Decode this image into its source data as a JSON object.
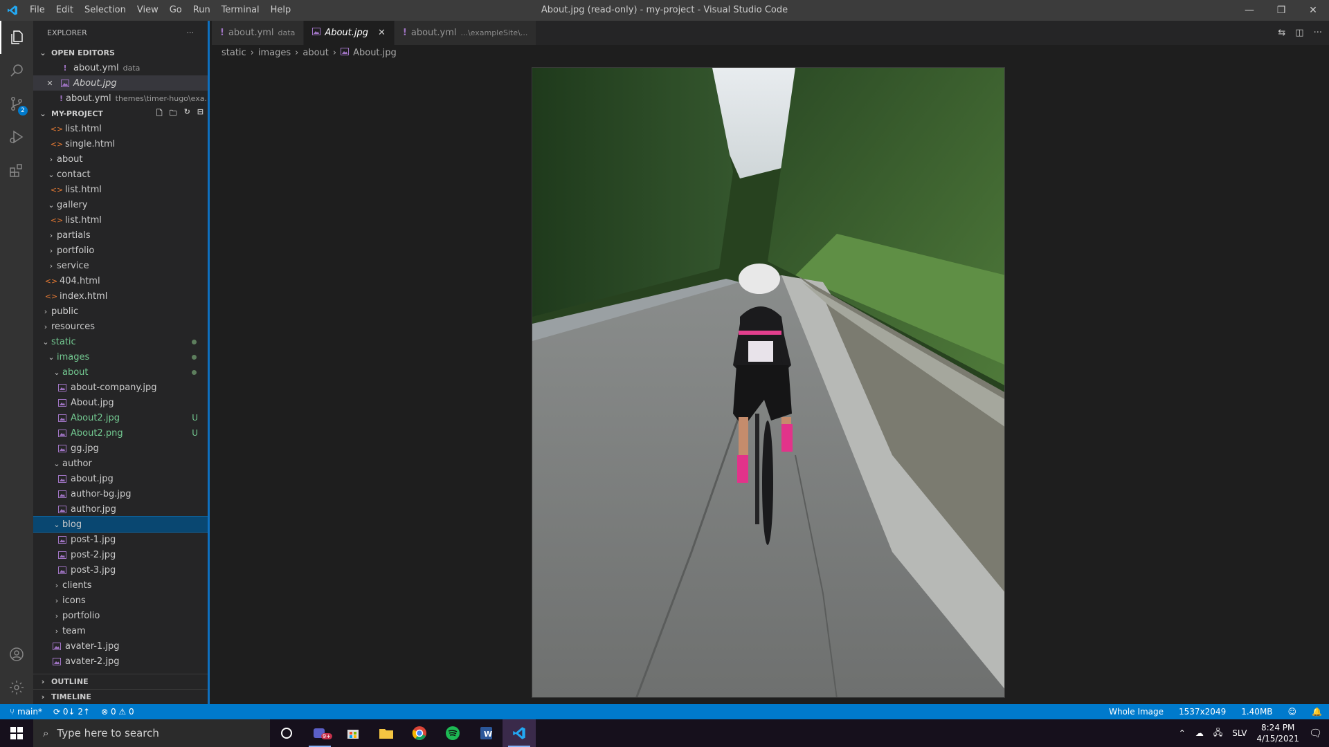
{
  "window": {
    "title": "About.jpg (read-only) - my-project - Visual Studio Code"
  },
  "menu": [
    "File",
    "Edit",
    "Selection",
    "View",
    "Go",
    "Run",
    "Terminal",
    "Help"
  ],
  "activity": {
    "scm_badge": "2"
  },
  "explorer": {
    "title": "EXPLORER",
    "more": "···",
    "open_editors": {
      "label": "OPEN EDITORS",
      "items": [
        {
          "name": "about.yml",
          "desc": "data"
        },
        {
          "name": "About.jpg",
          "desc": ""
        },
        {
          "name": "about.yml",
          "desc": "themes\\timer-hugo\\exa..."
        }
      ]
    },
    "project_label": "MY-PROJECT",
    "tree": [
      {
        "name": "list.html",
        "indent": 2,
        "type": "html"
      },
      {
        "name": "single.html",
        "indent": 2,
        "type": "html"
      },
      {
        "name": "about",
        "indent": 1,
        "type": "folder-closed"
      },
      {
        "name": "contact",
        "indent": 1,
        "type": "folder-open"
      },
      {
        "name": "list.html",
        "indent": 2,
        "type": "html"
      },
      {
        "name": "gallery",
        "indent": 1,
        "type": "folder-open"
      },
      {
        "name": "list.html",
        "indent": 2,
        "type": "html"
      },
      {
        "name": "partials",
        "indent": 1,
        "type": "folder-closed"
      },
      {
        "name": "portfolio",
        "indent": 1,
        "type": "folder-closed"
      },
      {
        "name": "service",
        "indent": 1,
        "type": "folder-closed"
      },
      {
        "name": "404.html",
        "indent": 1,
        "type": "html"
      },
      {
        "name": "index.html",
        "indent": 1,
        "type": "html"
      },
      {
        "name": "public",
        "indent": 0,
        "type": "folder-closed"
      },
      {
        "name": "resources",
        "indent": 0,
        "type": "folder-closed"
      },
      {
        "name": "static",
        "indent": 0,
        "type": "folder-open",
        "status": "dot",
        "green": true
      },
      {
        "name": "images",
        "indent": 1,
        "type": "folder-open",
        "status": "dot",
        "green": true
      },
      {
        "name": "about",
        "indent": 2,
        "type": "folder-open",
        "status": "dot",
        "green": true
      },
      {
        "name": "about-company.jpg",
        "indent": 3,
        "type": "image"
      },
      {
        "name": "About.jpg",
        "indent": 3,
        "type": "image"
      },
      {
        "name": "About2.jpg",
        "indent": 3,
        "type": "image",
        "status": "U",
        "green": true
      },
      {
        "name": "About2.png",
        "indent": 3,
        "type": "image",
        "status": "U",
        "green": true
      },
      {
        "name": "gg.jpg",
        "indent": 3,
        "type": "image"
      },
      {
        "name": "author",
        "indent": 2,
        "type": "folder-open"
      },
      {
        "name": "about.jpg",
        "indent": 3,
        "type": "image"
      },
      {
        "name": "author-bg.jpg",
        "indent": 3,
        "type": "image"
      },
      {
        "name": "author.jpg",
        "indent": 3,
        "type": "image"
      },
      {
        "name": "blog",
        "indent": 2,
        "type": "folder-open",
        "selected": true
      },
      {
        "name": "post-1.jpg",
        "indent": 3,
        "type": "image"
      },
      {
        "name": "post-2.jpg",
        "indent": 3,
        "type": "image"
      },
      {
        "name": "post-3.jpg",
        "indent": 3,
        "type": "image"
      },
      {
        "name": "clients",
        "indent": 2,
        "type": "folder-closed"
      },
      {
        "name": "icons",
        "indent": 2,
        "type": "folder-closed"
      },
      {
        "name": "portfolio",
        "indent": 2,
        "type": "folder-closed"
      },
      {
        "name": "team",
        "indent": 2,
        "type": "folder-closed"
      },
      {
        "name": "avater-1.jpg",
        "indent": 2,
        "type": "image"
      },
      {
        "name": "avater-2.jpg",
        "indent": 2,
        "type": "image"
      }
    ],
    "outline_label": "OUTLINE",
    "timeline_label": "TIMELINE"
  },
  "tabs": [
    {
      "name": "about.yml",
      "desc": "data",
      "active": false
    },
    {
      "name": "About.jpg",
      "desc": "",
      "active": true
    },
    {
      "name": "about.yml",
      "desc": "...\\exampleSite\\...",
      "active": false
    }
  ],
  "breadcrumb": [
    "static",
    "images",
    "about",
    "About.jpg"
  ],
  "status": {
    "branch": "main*",
    "sync": "0↓ 2↑",
    "errors": "0",
    "warnings": "0",
    "zoom": "Whole Image",
    "dimensions": "1537x2049",
    "filesize": "1.40MB"
  },
  "taskbar": {
    "search_placeholder": "Type here to search",
    "lang": "SLV",
    "time": "8:24 PM",
    "date": "4/15/2021",
    "teams_badge": "9+"
  },
  "colors": {
    "accent": "#007acc",
    "untracked": "#73c991",
    "selection": "#094771"
  }
}
